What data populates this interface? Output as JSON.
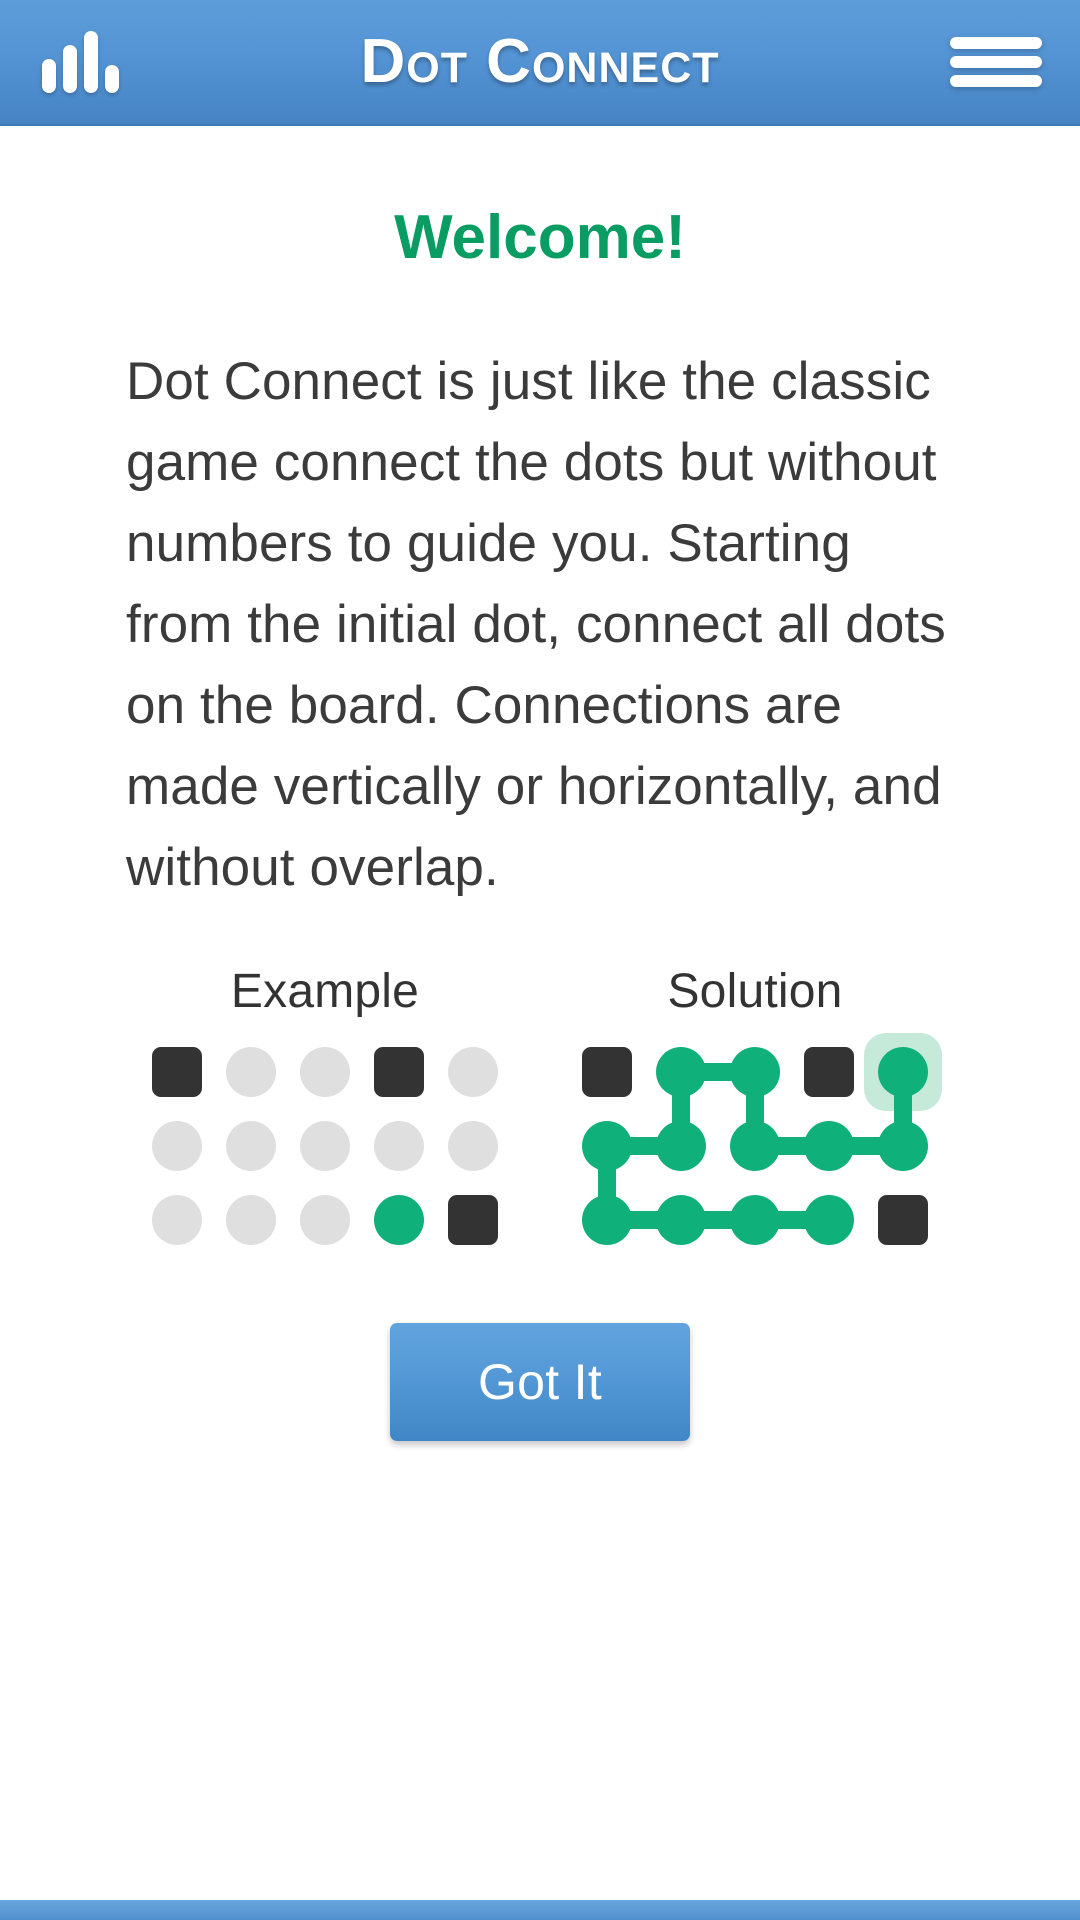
{
  "header": {
    "title": "Dot Connect",
    "stats_icon": "bar-chart-icon",
    "menu_icon": "hamburger-menu-icon",
    "gradient_top": "#5d9dda",
    "gradient_bottom": "#4684c4"
  },
  "main": {
    "welcome_title": "Welcome!",
    "welcome_color": "#0a9d63",
    "intro_text": "Dot Connect is just like the classic game connect the dots but without numbers to guide you. Starting from the initial dot, connect all dots on the board. Connections are made vertically or horizontally, and without overlap.",
    "got_it_label": "Got It"
  },
  "boards": {
    "cell_colors": {
      "empty": "#dfdfdf",
      "blocker": "#333333",
      "filled": "#10b07a",
      "halo": "#c6ead9"
    },
    "grid_size": {
      "rows": 3,
      "cols": 5
    },
    "example": {
      "label": "Example",
      "cells": [
        [
          "blocker",
          "empty",
          "empty",
          "blocker",
          "empty"
        ],
        [
          "empty",
          "empty",
          "empty",
          "empty",
          "empty"
        ],
        [
          "empty",
          "empty",
          "empty",
          "start",
          "blocker"
        ]
      ],
      "links": []
    },
    "solution": {
      "label": "Solution",
      "cells": [
        [
          "blocker",
          "filled",
          "filled",
          "blocker",
          "endpoint"
        ],
        [
          "filled",
          "filled",
          "filled",
          "filled",
          "filled"
        ],
        [
          "filled",
          "filled",
          "filled",
          "filled",
          "blocker"
        ]
      ],
      "links": [
        {
          "type": "h",
          "row": 0,
          "col": 1
        },
        {
          "type": "v",
          "row": 0,
          "col": 1
        },
        {
          "type": "v",
          "row": 0,
          "col": 2
        },
        {
          "type": "v",
          "row": 0,
          "col": 4
        },
        {
          "type": "h",
          "row": 1,
          "col": 0
        },
        {
          "type": "h",
          "row": 1,
          "col": 2
        },
        {
          "type": "h",
          "row": 1,
          "col": 3
        },
        {
          "type": "v",
          "row": 1,
          "col": 0
        },
        {
          "type": "h",
          "row": 2,
          "col": 0
        },
        {
          "type": "h",
          "row": 2,
          "col": 1
        },
        {
          "type": "h",
          "row": 2,
          "col": 2
        }
      ]
    }
  },
  "footer": {
    "bar_color": "#4f8fcd"
  }
}
